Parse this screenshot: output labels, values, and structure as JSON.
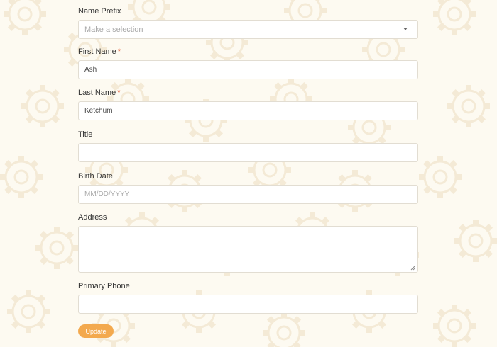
{
  "colors": {
    "background": "#fdfaf1",
    "gear": "#f6ecd8",
    "accent": "#f3a94e",
    "required": "#e4572e"
  },
  "form": {
    "name_prefix": {
      "label": "Name Prefix",
      "placeholder": "Make a selection",
      "value": ""
    },
    "first_name": {
      "label": "First Name",
      "required_mark": "*",
      "value": "Ash"
    },
    "last_name": {
      "label": "Last Name",
      "required_mark": "*",
      "value": "Ketchum"
    },
    "title": {
      "label": "Title",
      "value": ""
    },
    "birth_date": {
      "label": "Birth Date",
      "placeholder": "MM/DD/YYYY",
      "value": ""
    },
    "address": {
      "label": "Address",
      "value": ""
    },
    "primary_phone": {
      "label": "Primary Phone",
      "value": ""
    },
    "update_button": "Update"
  }
}
